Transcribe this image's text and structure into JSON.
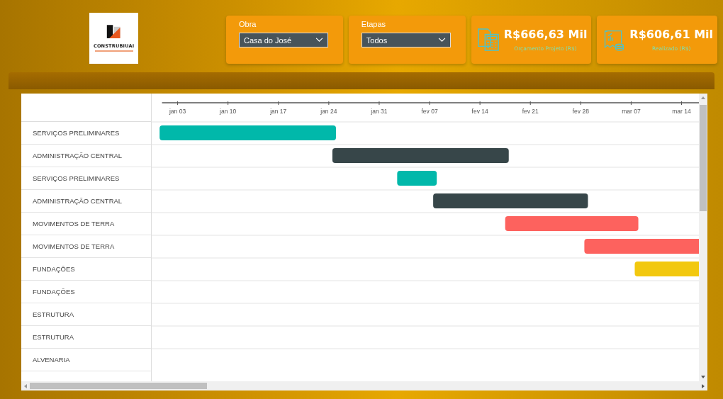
{
  "logo": {
    "text": "CONSTRUBIUAI"
  },
  "filters": [
    {
      "label": "Obra",
      "value": "Casa do José"
    },
    {
      "label": "Etapas",
      "value": "Todos"
    }
  ],
  "kpis": [
    {
      "kind": "calculator",
      "value": "R$666,63 Mil",
      "label": "Orçamento Projeto (R$)"
    },
    {
      "kind": "receipt",
      "value": "R$606,61 Mil",
      "label": "Realizado (R$)"
    }
  ],
  "timeline": {
    "ticks": [
      "jan 03",
      "jan 10",
      "jan 17",
      "jan 24",
      "jan 31",
      "fev 07",
      "fev 14",
      "fev 21",
      "fev 28",
      "mar 07",
      "mar 14"
    ]
  },
  "tasks": [
    {
      "label": "SERVIÇOS PRELIMINARES",
      "color": "#01b8aa"
    },
    {
      "label": "ADMINISTRAÇÃO CENTRAL",
      "color": "#374649"
    },
    {
      "label": "SERVIÇOS PRELIMINARES",
      "color": "#01b8aa"
    },
    {
      "label": "ADMINISTRAÇÃO CENTRAL",
      "color": "#374649"
    },
    {
      "label": "MOVIMENTOS DE TERRA",
      "color": "#fd625e"
    },
    {
      "label": "MOVIMENTOS DE TERRA",
      "color": "#fd625e"
    },
    {
      "label": "FUNDAÇÕES",
      "color": "#f2c80f"
    },
    {
      "label": "FUNDAÇÕES"
    },
    {
      "label": "ESTRUTURA"
    },
    {
      "label": "ESTRUTURA"
    },
    {
      "label": "ALVENARIA"
    }
  ]
}
